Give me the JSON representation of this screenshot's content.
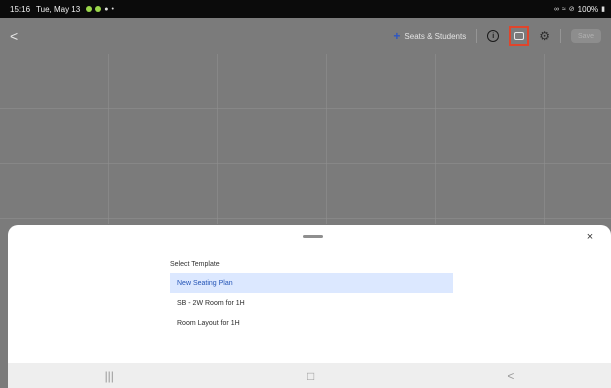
{
  "status_bar": {
    "time": "15:16",
    "date": "Tue, May 13",
    "battery": "100%"
  },
  "app_bar": {
    "back_label": "<",
    "seats_button_label": "Seats & Students",
    "info_label": "i",
    "save_label": "Save"
  },
  "sheet": {
    "title": "Select Template",
    "close_label": "×",
    "templates": [
      {
        "label": "New Seating Plan"
      },
      {
        "label": "SB - 2W Room for 1H"
      },
      {
        "label": "Room Layout for 1H"
      }
    ],
    "selected_index": 0
  },
  "nav": {
    "recent_label": "|||",
    "home_label": "□",
    "back_label": "<"
  },
  "colors": {
    "accent": "#2c56c5",
    "highlight": "#e0452b",
    "selected_bg": "#dce8ff"
  }
}
